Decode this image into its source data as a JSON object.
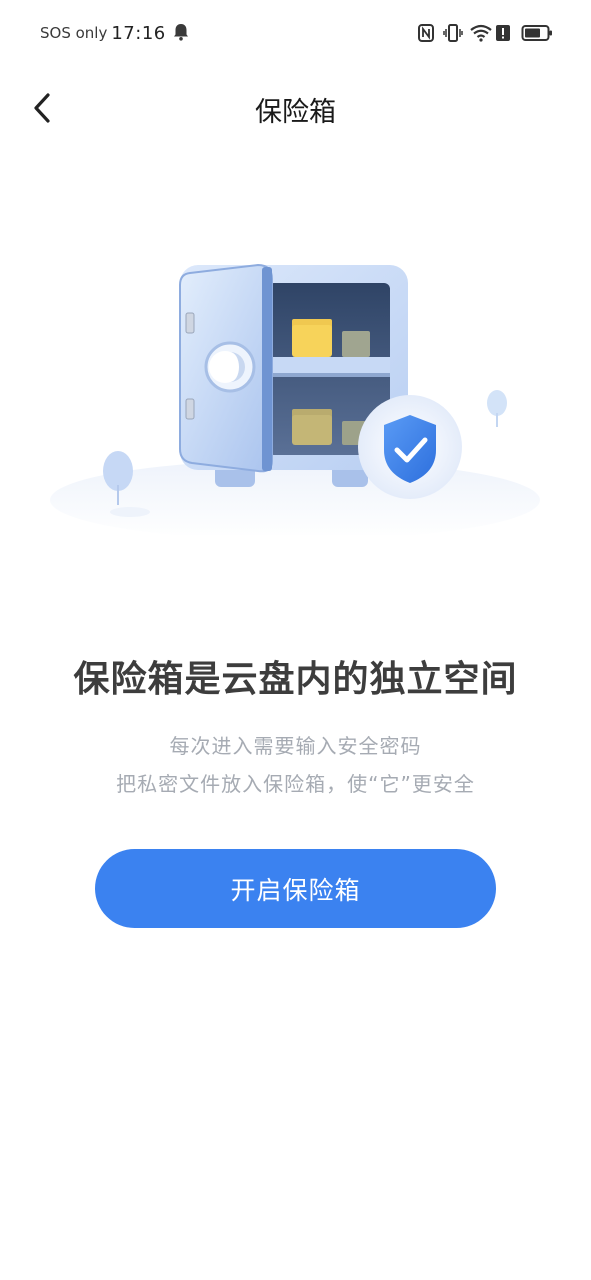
{
  "status_bar": {
    "carrier": "SOS only",
    "time": "17:16",
    "icons": [
      "notification-bell-icon",
      "nfc-icon",
      "vibrate-icon",
      "wifi-icon",
      "alert-icon",
      "battery-icon"
    ]
  },
  "header": {
    "title": "保险箱",
    "back_icon": "chevron-left-icon"
  },
  "illustration": {
    "description_icons": [
      "safe-icon",
      "folder-icon",
      "shield-check-icon"
    ]
  },
  "content": {
    "headline": "保险箱是云盘内的独立空间",
    "desc_line_1": "每次进入需要输入安全密码",
    "desc_line_2": "把私密文件放入保险箱，使“它”更安全"
  },
  "actions": {
    "enable_label": "开启保险箱"
  },
  "colors": {
    "primary": "#3b82f0",
    "headline": "#3d3d3d",
    "desc": "#a6abb3",
    "background": "#ffffff"
  }
}
